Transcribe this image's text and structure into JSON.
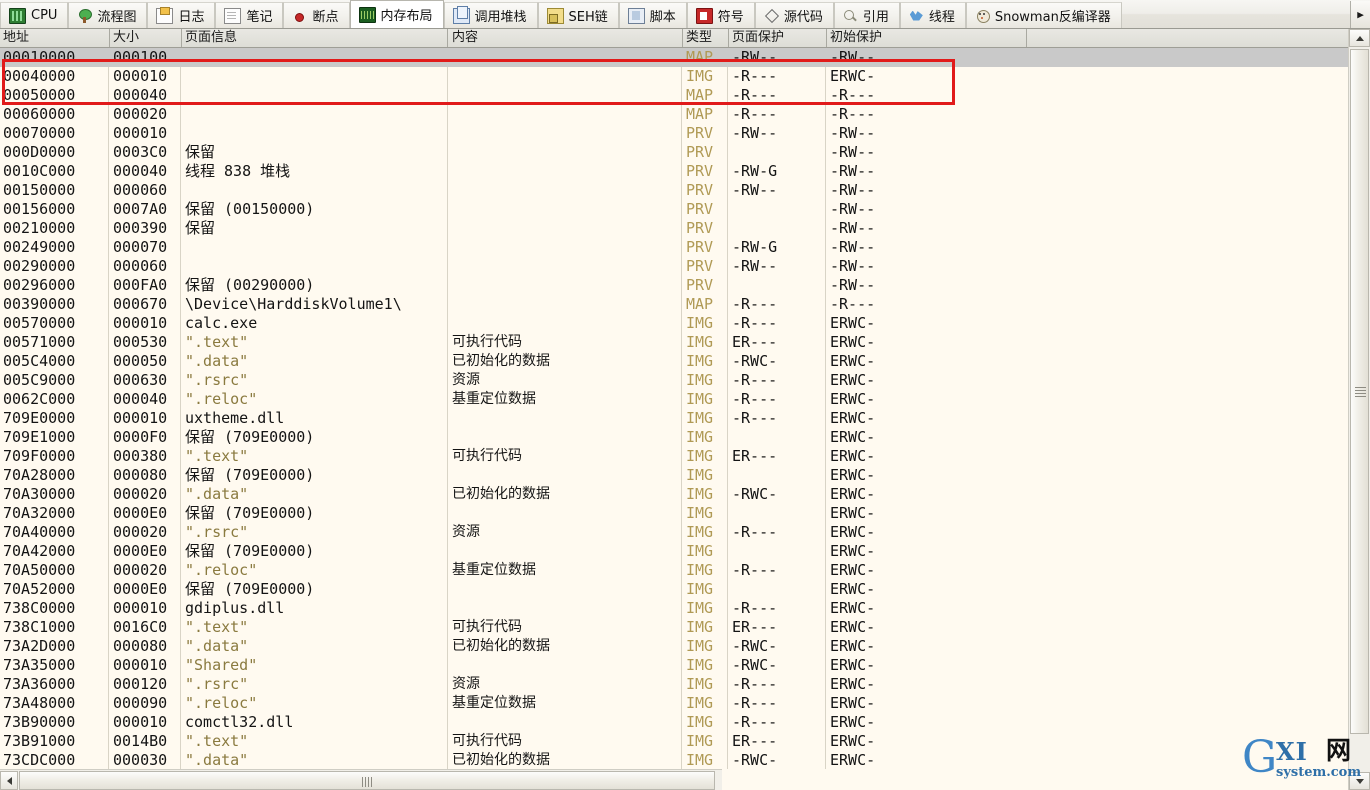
{
  "tabs": [
    {
      "label": "CPU",
      "icon": "cpu-chip-icon",
      "icon_class": "ic-cpu",
      "active": false
    },
    {
      "label": "流程图",
      "icon": "tree-icon",
      "icon_class": "ic-tree",
      "active": false
    },
    {
      "label": "日志",
      "icon": "log-page-icon",
      "icon_class": "ic-pagey",
      "active": false
    },
    {
      "label": "笔记",
      "icon": "notes-page-icon",
      "icon_class": "ic-page",
      "active": false
    },
    {
      "label": "断点",
      "icon": "red-dot-icon",
      "icon_class": "ic-dot",
      "active": false
    },
    {
      "label": "内存布局",
      "icon": "memory-icon",
      "icon_class": "ic-mem",
      "active": true
    },
    {
      "label": "调用堆栈",
      "icon": "stack-icon",
      "icon_class": "ic-stack",
      "active": false
    },
    {
      "label": "SEH链",
      "icon": "seh-icon",
      "icon_class": "ic-seh",
      "active": false
    },
    {
      "label": "脚本",
      "icon": "script-icon",
      "icon_class": "ic-script",
      "active": false
    },
    {
      "label": "符号",
      "icon": "symbol-icon",
      "icon_class": "ic-sym",
      "active": false
    },
    {
      "label": "源代码",
      "icon": "diamond-icon",
      "icon_class": "ic-diamond",
      "active": false
    },
    {
      "label": "引用",
      "icon": "magnifier-icon",
      "icon_class": "ic-mag",
      "active": false
    },
    {
      "label": "线程",
      "icon": "thread-icon",
      "icon_class": "ic-thread",
      "active": false
    },
    {
      "label": "Snowman反编译器",
      "icon": "snowman-icon",
      "icon_class": "ic-snow",
      "active": false
    }
  ],
  "tab_scroll_label": "▶",
  "columns": [
    {
      "key": "addr",
      "label": "地址"
    },
    {
      "key": "size",
      "label": "大小"
    },
    {
      "key": "info",
      "label": "页面信息"
    },
    {
      "key": "content",
      "label": "内容"
    },
    {
      "key": "type",
      "label": "类型"
    },
    {
      "key": "prot",
      "label": "页面保护"
    },
    {
      "key": "init",
      "label": "初始保护"
    }
  ],
  "rows": [
    {
      "addr": "00010000",
      "size": "000100",
      "info": "",
      "content": "",
      "type": "MAP",
      "prot": "-RW--",
      "init": "-RW--",
      "selected": true
    },
    {
      "addr": "00040000",
      "size": "000010",
      "info": "",
      "content": "",
      "type": "IMG",
      "prot": "-R---",
      "init": "ERWC-",
      "selected": false
    },
    {
      "addr": "00050000",
      "size": "000040",
      "info": "",
      "content": "",
      "type": "MAP",
      "prot": "-R---",
      "init": "-R---",
      "selected": false
    },
    {
      "addr": "00060000",
      "size": "000020",
      "info": "",
      "content": "",
      "type": "MAP",
      "prot": "-R---",
      "init": "-R---",
      "selected": false
    },
    {
      "addr": "00070000",
      "size": "000010",
      "info": "",
      "content": "",
      "type": "PRV",
      "prot": "-RW--",
      "init": "-RW--",
      "selected": false
    },
    {
      "addr": "000D0000",
      "size": "0003C0",
      "info": "保留",
      "content": "",
      "type": "PRV",
      "prot": "",
      "init": "-RW--",
      "selected": false
    },
    {
      "addr": "0010C000",
      "size": "000040",
      "info": "线程 838 堆栈",
      "content": "",
      "type": "PRV",
      "prot": "-RW-G",
      "init": "-RW--",
      "selected": false
    },
    {
      "addr": "00150000",
      "size": "000060",
      "info": "",
      "content": "",
      "type": "PRV",
      "prot": "-RW--",
      "init": "-RW--",
      "selected": false
    },
    {
      "addr": "00156000",
      "size": "0007A0",
      "info": "保留 (00150000)",
      "content": "",
      "type": "PRV",
      "prot": "",
      "init": "-RW--",
      "selected": false
    },
    {
      "addr": "00210000",
      "size": "000390",
      "info": "保留",
      "content": "",
      "type": "PRV",
      "prot": "",
      "init": "-RW--",
      "selected": false
    },
    {
      "addr": "00249000",
      "size": "000070",
      "info": "",
      "content": "",
      "type": "PRV",
      "prot": "-RW-G",
      "init": "-RW--",
      "selected": false
    },
    {
      "addr": "00290000",
      "size": "000060",
      "info": "",
      "content": "",
      "type": "PRV",
      "prot": "-RW--",
      "init": "-RW--",
      "selected": false
    },
    {
      "addr": "00296000",
      "size": "000FA0",
      "info": "保留 (00290000)",
      "content": "",
      "type": "PRV",
      "prot": "",
      "init": "-RW--",
      "selected": false
    },
    {
      "addr": "00390000",
      "size": "000670",
      "info": "\\Device\\HarddiskVolume1\\",
      "content": "",
      "type": "MAP",
      "prot": "-R---",
      "init": "-R---",
      "selected": false
    },
    {
      "addr": "00570000",
      "size": "000010",
      "info": "calc.exe",
      "content": "",
      "type": "IMG",
      "prot": "-R---",
      "init": "ERWC-",
      "selected": false
    },
    {
      "addr": "00571000",
      "size": "000530",
      "info": "\".text\"",
      "content": "可执行代码",
      "type": "IMG",
      "prot": "ER---",
      "init": "ERWC-",
      "selected": false,
      "quoted": true
    },
    {
      "addr": "005C4000",
      "size": "000050",
      "info": "\".data\"",
      "content": "已初始化的数据",
      "type": "IMG",
      "prot": "-RWC-",
      "init": "ERWC-",
      "selected": false,
      "quoted": true
    },
    {
      "addr": "005C9000",
      "size": "000630",
      "info": "\".rsrc\"",
      "content": "资源",
      "type": "IMG",
      "prot": "-R---",
      "init": "ERWC-",
      "selected": false,
      "quoted": true
    },
    {
      "addr": "0062C000",
      "size": "000040",
      "info": "\".reloc\"",
      "content": "基重定位数据",
      "type": "IMG",
      "prot": "-R---",
      "init": "ERWC-",
      "selected": false,
      "quoted": true
    },
    {
      "addr": "709E0000",
      "size": "000010",
      "info": "uxtheme.dll",
      "content": "",
      "type": "IMG",
      "prot": "-R---",
      "init": "ERWC-",
      "selected": false
    },
    {
      "addr": "709E1000",
      "size": "0000F0",
      "info": "保留 (709E0000)",
      "content": "",
      "type": "IMG",
      "prot": "",
      "init": "ERWC-",
      "selected": false
    },
    {
      "addr": "709F0000",
      "size": "000380",
      "info": "\".text\"",
      "content": "可执行代码",
      "type": "IMG",
      "prot": "ER---",
      "init": "ERWC-",
      "selected": false,
      "quoted": true
    },
    {
      "addr": "70A28000",
      "size": "000080",
      "info": "保留 (709E0000)",
      "content": "",
      "type": "IMG",
      "prot": "",
      "init": "ERWC-",
      "selected": false
    },
    {
      "addr": "70A30000",
      "size": "000020",
      "info": "\".data\"",
      "content": "已初始化的数据",
      "type": "IMG",
      "prot": "-RWC-",
      "init": "ERWC-",
      "selected": false,
      "quoted": true
    },
    {
      "addr": "70A32000",
      "size": "0000E0",
      "info": "保留 (709E0000)",
      "content": "",
      "type": "IMG",
      "prot": "",
      "init": "ERWC-",
      "selected": false
    },
    {
      "addr": "70A40000",
      "size": "000020",
      "info": "\".rsrc\"",
      "content": "资源",
      "type": "IMG",
      "prot": "-R---",
      "init": "ERWC-",
      "selected": false,
      "quoted": true
    },
    {
      "addr": "70A42000",
      "size": "0000E0",
      "info": "保留 (709E0000)",
      "content": "",
      "type": "IMG",
      "prot": "",
      "init": "ERWC-",
      "selected": false
    },
    {
      "addr": "70A50000",
      "size": "000020",
      "info": "\".reloc\"",
      "content": "基重定位数据",
      "type": "IMG",
      "prot": "-R---",
      "init": "ERWC-",
      "selected": false,
      "quoted": true
    },
    {
      "addr": "70A52000",
      "size": "0000E0",
      "info": "保留 (709E0000)",
      "content": "",
      "type": "IMG",
      "prot": "",
      "init": "ERWC-",
      "selected": false
    },
    {
      "addr": "738C0000",
      "size": "000010",
      "info": "gdiplus.dll",
      "content": "",
      "type": "IMG",
      "prot": "-R---",
      "init": "ERWC-",
      "selected": false
    },
    {
      "addr": "738C1000",
      "size": "0016C0",
      "info": "\".text\"",
      "content": "可执行代码",
      "type": "IMG",
      "prot": "ER---",
      "init": "ERWC-",
      "selected": false,
      "quoted": true
    },
    {
      "addr": "73A2D000",
      "size": "000080",
      "info": "\".data\"",
      "content": "已初始化的数据",
      "type": "IMG",
      "prot": "-RWC-",
      "init": "ERWC-",
      "selected": false,
      "quoted": true
    },
    {
      "addr": "73A35000",
      "size": "000010",
      "info": "\"Shared\"",
      "content": "",
      "type": "IMG",
      "prot": "-RWC-",
      "init": "ERWC-",
      "selected": false,
      "quoted": true
    },
    {
      "addr": "73A36000",
      "size": "000120",
      "info": "\".rsrc\"",
      "content": "资源",
      "type": "IMG",
      "prot": "-R---",
      "init": "ERWC-",
      "selected": false,
      "quoted": true
    },
    {
      "addr": "73A48000",
      "size": "000090",
      "info": "\".reloc\"",
      "content": "基重定位数据",
      "type": "IMG",
      "prot": "-R---",
      "init": "ERWC-",
      "selected": false,
      "quoted": true
    },
    {
      "addr": "73B90000",
      "size": "000010",
      "info": "comctl32.dll",
      "content": "",
      "type": "IMG",
      "prot": "-R---",
      "init": "ERWC-",
      "selected": false
    },
    {
      "addr": "73B91000",
      "size": "0014B0",
      "info": "\".text\"",
      "content": "可执行代码",
      "type": "IMG",
      "prot": "ER---",
      "init": "ERWC-",
      "selected": false,
      "quoted": true
    },
    {
      "addr": "73CDC000",
      "size": "000030",
      "info": "\".data\"",
      "content": "已初始化的数据",
      "type": "IMG",
      "prot": "-RWC-",
      "init": "ERWC-",
      "selected": false,
      "quoted": true
    }
  ],
  "annotation": {
    "name": "red-highlight-rectangle",
    "color": "#e11a1a"
  },
  "scroll": {
    "vertical_up": "▲",
    "vertical_down": "▼",
    "horizontal_left": "◀",
    "horizontal_grip": "|||"
  },
  "watermark": {
    "g": "G",
    "xi": "XI",
    "cn": "网",
    "domain": "system.com"
  }
}
